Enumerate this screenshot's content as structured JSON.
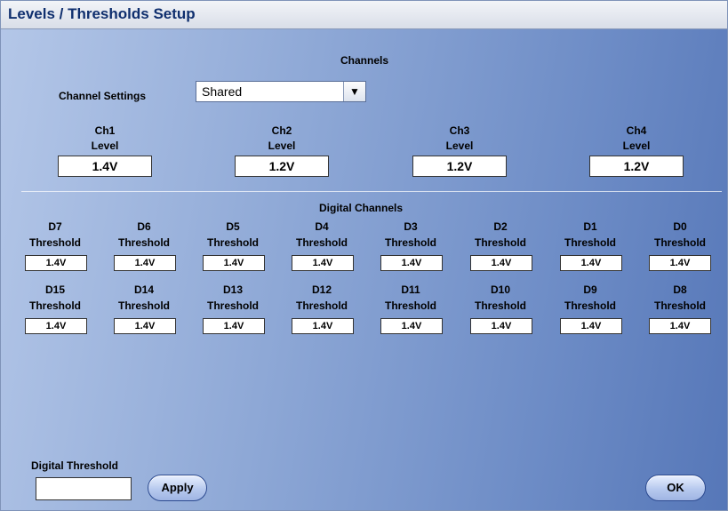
{
  "window": {
    "title": "Levels / Thresholds Setup"
  },
  "channels": {
    "heading": "Channels",
    "settings_label": "Channel Settings",
    "settings_value": "Shared",
    "dropdown_arrow": "▼",
    "items": [
      {
        "name": "Ch1",
        "sub": "Level",
        "value": "1.4V"
      },
      {
        "name": "Ch2",
        "sub": "Level",
        "value": "1.2V"
      },
      {
        "name": "Ch3",
        "sub": "Level",
        "value": "1.2V"
      },
      {
        "name": "Ch4",
        "sub": "Level",
        "value": "1.2V"
      }
    ]
  },
  "digital": {
    "heading": "Digital Channels",
    "row1": [
      {
        "name": "D7",
        "sub": "Threshold",
        "value": "1.4V"
      },
      {
        "name": "D6",
        "sub": "Threshold",
        "value": "1.4V"
      },
      {
        "name": "D5",
        "sub": "Threshold",
        "value": "1.4V"
      },
      {
        "name": "D4",
        "sub": "Threshold",
        "value": "1.4V"
      },
      {
        "name": "D3",
        "sub": "Threshold",
        "value": "1.4V"
      },
      {
        "name": "D2",
        "sub": "Threshold",
        "value": "1.4V"
      },
      {
        "name": "D1",
        "sub": "Threshold",
        "value": "1.4V"
      },
      {
        "name": "D0",
        "sub": "Threshold",
        "value": "1.4V"
      }
    ],
    "row2": [
      {
        "name": "D15",
        "sub": "Threshold",
        "value": "1.4V"
      },
      {
        "name": "D14",
        "sub": "Threshold",
        "value": "1.4V"
      },
      {
        "name": "D13",
        "sub": "Threshold",
        "value": "1.4V"
      },
      {
        "name": "D12",
        "sub": "Threshold",
        "value": "1.4V"
      },
      {
        "name": "D11",
        "sub": "Threshold",
        "value": "1.4V"
      },
      {
        "name": "D10",
        "sub": "Threshold",
        "value": "1.4V"
      },
      {
        "name": "D9",
        "sub": "Threshold",
        "value": "1.4V"
      },
      {
        "name": "D8",
        "sub": "Threshold",
        "value": "1.4V"
      }
    ]
  },
  "footer": {
    "digital_threshold_label": "Digital Threshold",
    "digital_threshold_value": "",
    "apply_label": "Apply",
    "ok_label": "OK"
  }
}
